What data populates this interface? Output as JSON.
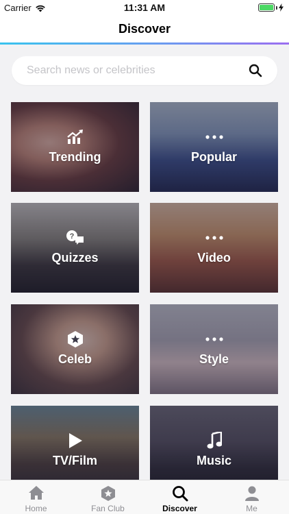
{
  "status_bar": {
    "carrier": "Carrier",
    "time": "11:31 AM",
    "battery_level": 1.0
  },
  "nav": {
    "title": "Discover"
  },
  "search": {
    "placeholder": "Search news or celebrities"
  },
  "tiles": [
    {
      "label": "Trending",
      "icon": "trending-chart-icon"
    },
    {
      "label": "Popular",
      "icon": "dots-icon"
    },
    {
      "label": "Quizzes",
      "icon": "question-chat-icon"
    },
    {
      "label": "Video",
      "icon": "dots-icon"
    },
    {
      "label": "Celeb",
      "icon": "star-hexagon-icon"
    },
    {
      "label": "Style",
      "icon": "dots-icon"
    },
    {
      "label": "TV/Film",
      "icon": "play-icon"
    },
    {
      "label": "Music",
      "icon": "music-note-icon"
    }
  ],
  "tab_bar": {
    "items": [
      {
        "label": "Home",
        "icon": "home-icon"
      },
      {
        "label": "Fan Club",
        "icon": "fan-club-hexagon-icon"
      },
      {
        "label": "Discover",
        "icon": "search-icon",
        "active": true
      },
      {
        "label": "Me",
        "icon": "person-icon"
      }
    ]
  },
  "colors": {
    "accent_gradient_start": "#39c3ee",
    "accent_gradient_end": "#9b6ef0",
    "active_tab": "#000000",
    "inactive_tab": "#8e8e93"
  }
}
